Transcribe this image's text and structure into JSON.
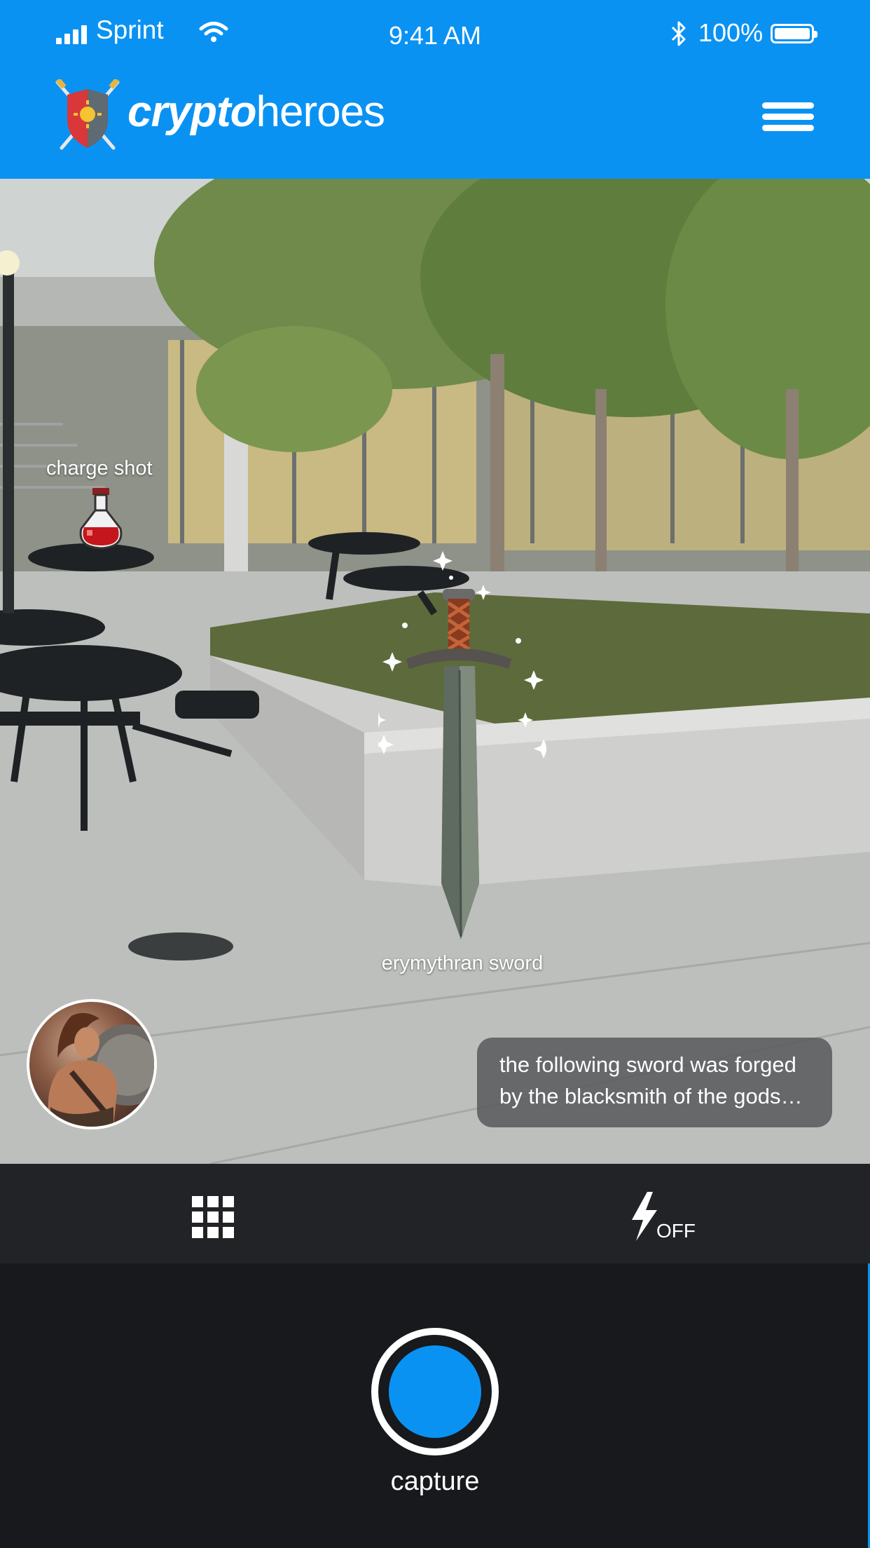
{
  "status_bar": {
    "carrier": "Sprint",
    "time": "9:41 AM",
    "battery": "100%"
  },
  "header": {
    "brand_bold": "crypto",
    "brand_light": "heroes",
    "accent_color": "#0a92f3"
  },
  "scene": {
    "items": [
      {
        "label": "charge shot",
        "icon": "potion-icon"
      },
      {
        "label": "erymythran sword",
        "icon": "sword-icon"
      }
    ],
    "message": "the following sword was forged by the blacksmith of the gods…"
  },
  "toolbar": {
    "grid_icon": "grid-icon",
    "flash_icon": "lightning-icon",
    "flash_state": "OFF"
  },
  "capture": {
    "label": "capture"
  }
}
